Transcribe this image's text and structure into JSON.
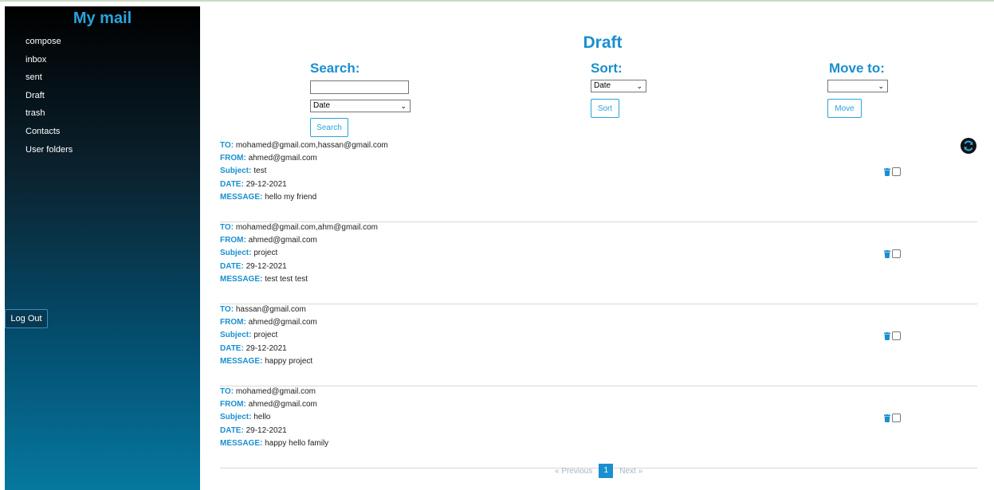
{
  "sidebar": {
    "brand": "My mail",
    "items": [
      {
        "label": "compose"
      },
      {
        "label": "inbox"
      },
      {
        "label": "sent"
      },
      {
        "label": "Draft"
      },
      {
        "label": "trash"
      },
      {
        "label": "Contacts"
      },
      {
        "label": "User folders"
      }
    ],
    "logout_label": "Log Out"
  },
  "colors": {
    "accent": "#1a8fd0",
    "sidebar_top": "#000000",
    "sidebar_bottom": "#06789f"
  },
  "main": {
    "title": "Draft",
    "search": {
      "label": "Search:",
      "input_value": "",
      "select_value": "Date",
      "button_label": "Search"
    },
    "sort": {
      "label": "Sort:",
      "select_value": "Date",
      "button_label": "Sort"
    },
    "move": {
      "label": "Move to:",
      "select_value": "",
      "button_label": "Move"
    },
    "field_labels": {
      "to": "TO:",
      "from": "FROM:",
      "subject": "Subject:",
      "date": "DATE:",
      "message": "MESSAGE:"
    },
    "emails": [
      {
        "to": "mohamed@gmail.com,hassan@gmail.com",
        "from": "ahmed@gmail.com",
        "subject": "test",
        "date": "29-12-2021",
        "message": "hello my friend"
      },
      {
        "to": "mohamed@gmail.com,ahm@gmail.com",
        "from": "ahmed@gmail.com",
        "subject": "project",
        "date": "29-12-2021",
        "message": "test test test"
      },
      {
        "to": "hassan@gmail.com",
        "from": "ahmed@gmail.com",
        "subject": "project",
        "date": "29-12-2021",
        "message": "happy project"
      },
      {
        "to": "mohamed@gmail.com",
        "from": "ahmed@gmail.com",
        "subject": "hello",
        "date": "29-12-2021",
        "message": "happy hello family"
      }
    ],
    "pagination": {
      "previous_label": "« Previous",
      "current_page": "1",
      "next_label": "Next »"
    }
  }
}
